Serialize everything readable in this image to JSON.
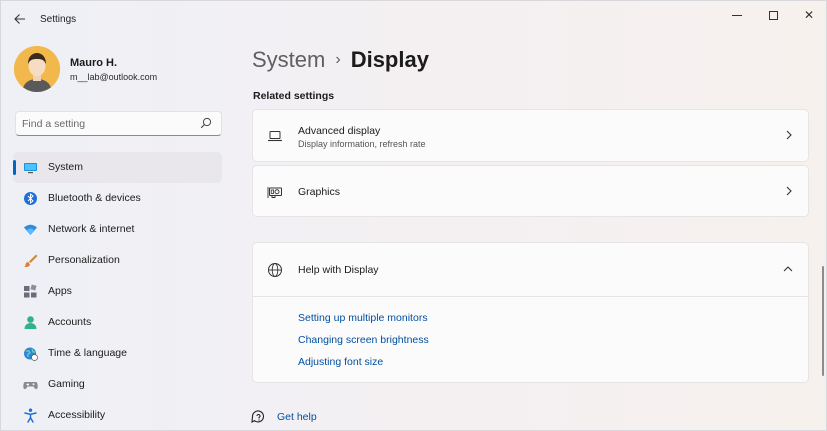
{
  "window": {
    "title": "Settings",
    "controls": {
      "minimize": "minimize",
      "maximize": "maximize",
      "close": "✕"
    }
  },
  "profile": {
    "name": "Mauro H.",
    "email": "m__lab@outlook.com"
  },
  "search": {
    "placeholder": "Find a setting",
    "value": ""
  },
  "nav": {
    "items": [
      {
        "label": "System",
        "icon": "monitor-icon",
        "active": true
      },
      {
        "label": "Bluetooth & devices",
        "icon": "bluetooth-icon"
      },
      {
        "label": "Network & internet",
        "icon": "wifi-icon"
      },
      {
        "label": "Personalization",
        "icon": "brush-icon"
      },
      {
        "label": "Apps",
        "icon": "apps-icon"
      },
      {
        "label": "Accounts",
        "icon": "accounts-icon"
      },
      {
        "label": "Time & language",
        "icon": "globe-clock-icon"
      },
      {
        "label": "Gaming",
        "icon": "gamepad-icon"
      },
      {
        "label": "Accessibility",
        "icon": "accessibility-icon"
      }
    ]
  },
  "breadcrumb": {
    "parent": "System",
    "separator": "›",
    "current": "Display"
  },
  "related": {
    "title": "Related settings",
    "items": [
      {
        "title": "Advanced display",
        "subtitle": "Display information, refresh rate",
        "icon": "laptop-icon"
      },
      {
        "title": "Graphics",
        "subtitle": "",
        "icon": "graphics-card-icon"
      }
    ]
  },
  "help": {
    "title": "Help with Display",
    "icon": "globe-icon",
    "expanded": true,
    "links": [
      "Setting up multiple monitors",
      "Changing screen brightness",
      "Adjusting font size"
    ]
  },
  "get_help": {
    "label": "Get help",
    "icon": "help-chat-icon"
  },
  "colors": {
    "accent": "#0067c0",
    "link": "#0050a0",
    "avatar_bg": "#f2b84b"
  }
}
